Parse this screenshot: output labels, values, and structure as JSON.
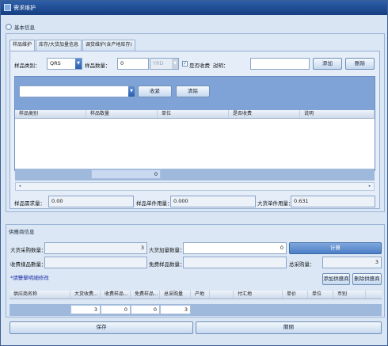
{
  "window": {
    "title": "需求维护"
  },
  "basic": {
    "title": "基本信息",
    "tabs": [
      "样品维护",
      "库存/大货加量信息",
      "调货维护(含产地库存)"
    ],
    "sample_type_label": "样品类别：",
    "sample_type_value": "QRS",
    "sample_qty_label": "样品数量：",
    "sample_qty_value": "0",
    "unit_value": "YRD",
    "charge_label": "是否收费",
    "charge_checked": true,
    "note_label": "説明：",
    "note_value": "",
    "add_label": "添加",
    "delete_label": "刪除",
    "filter_value": "",
    "collect_label": "收紧",
    "clear_label": "清除",
    "columns": [
      "样品类别",
      "样品数量",
      "单位",
      "是否收费",
      "说明"
    ],
    "footer_total": "0",
    "sample_demand_label": "样品需求量：",
    "sample_demand_value": "0.00",
    "sample_unit_usage_label": "样品单件用量：",
    "sample_unit_usage_value": "0.000",
    "bulk_unit_usage_label": "大货单件用量：",
    "bulk_unit_usage_value": "0.631"
  },
  "supplier": {
    "title": "供應商信息",
    "bulk_purchase_label": "大货采购数量：",
    "bulk_purchase_value": "3",
    "bulk_add_label": "大货加量数量：",
    "bulk_add_value": "0",
    "calc_label": "计算",
    "charged_sample_label": "收費樣品數量：",
    "charged_sample_value": "",
    "free_sample_label": "免费样品数量：",
    "free_sample_value": "",
    "total_purchase_label": "总采购量：",
    "total_purchase_value": "3",
    "hint_text": "*請雙擊明細修改",
    "add_supplier_label": "添加供應商",
    "delete_supplier_label": "刪除供應商",
    "columns": [
      "供应商名称",
      "大货收费...",
      "收费样品...",
      "免费样品...",
      "总采购量",
      "产地",
      "",
      "付汇地",
      "单价",
      "单位",
      "币别"
    ],
    "totals": [
      "",
      "3",
      "0",
      "0",
      "3",
      "",
      "",
      "",
      "",
      "",
      ""
    ]
  },
  "footer": {
    "save_label": "保存",
    "close_label": "關閉"
  }
}
